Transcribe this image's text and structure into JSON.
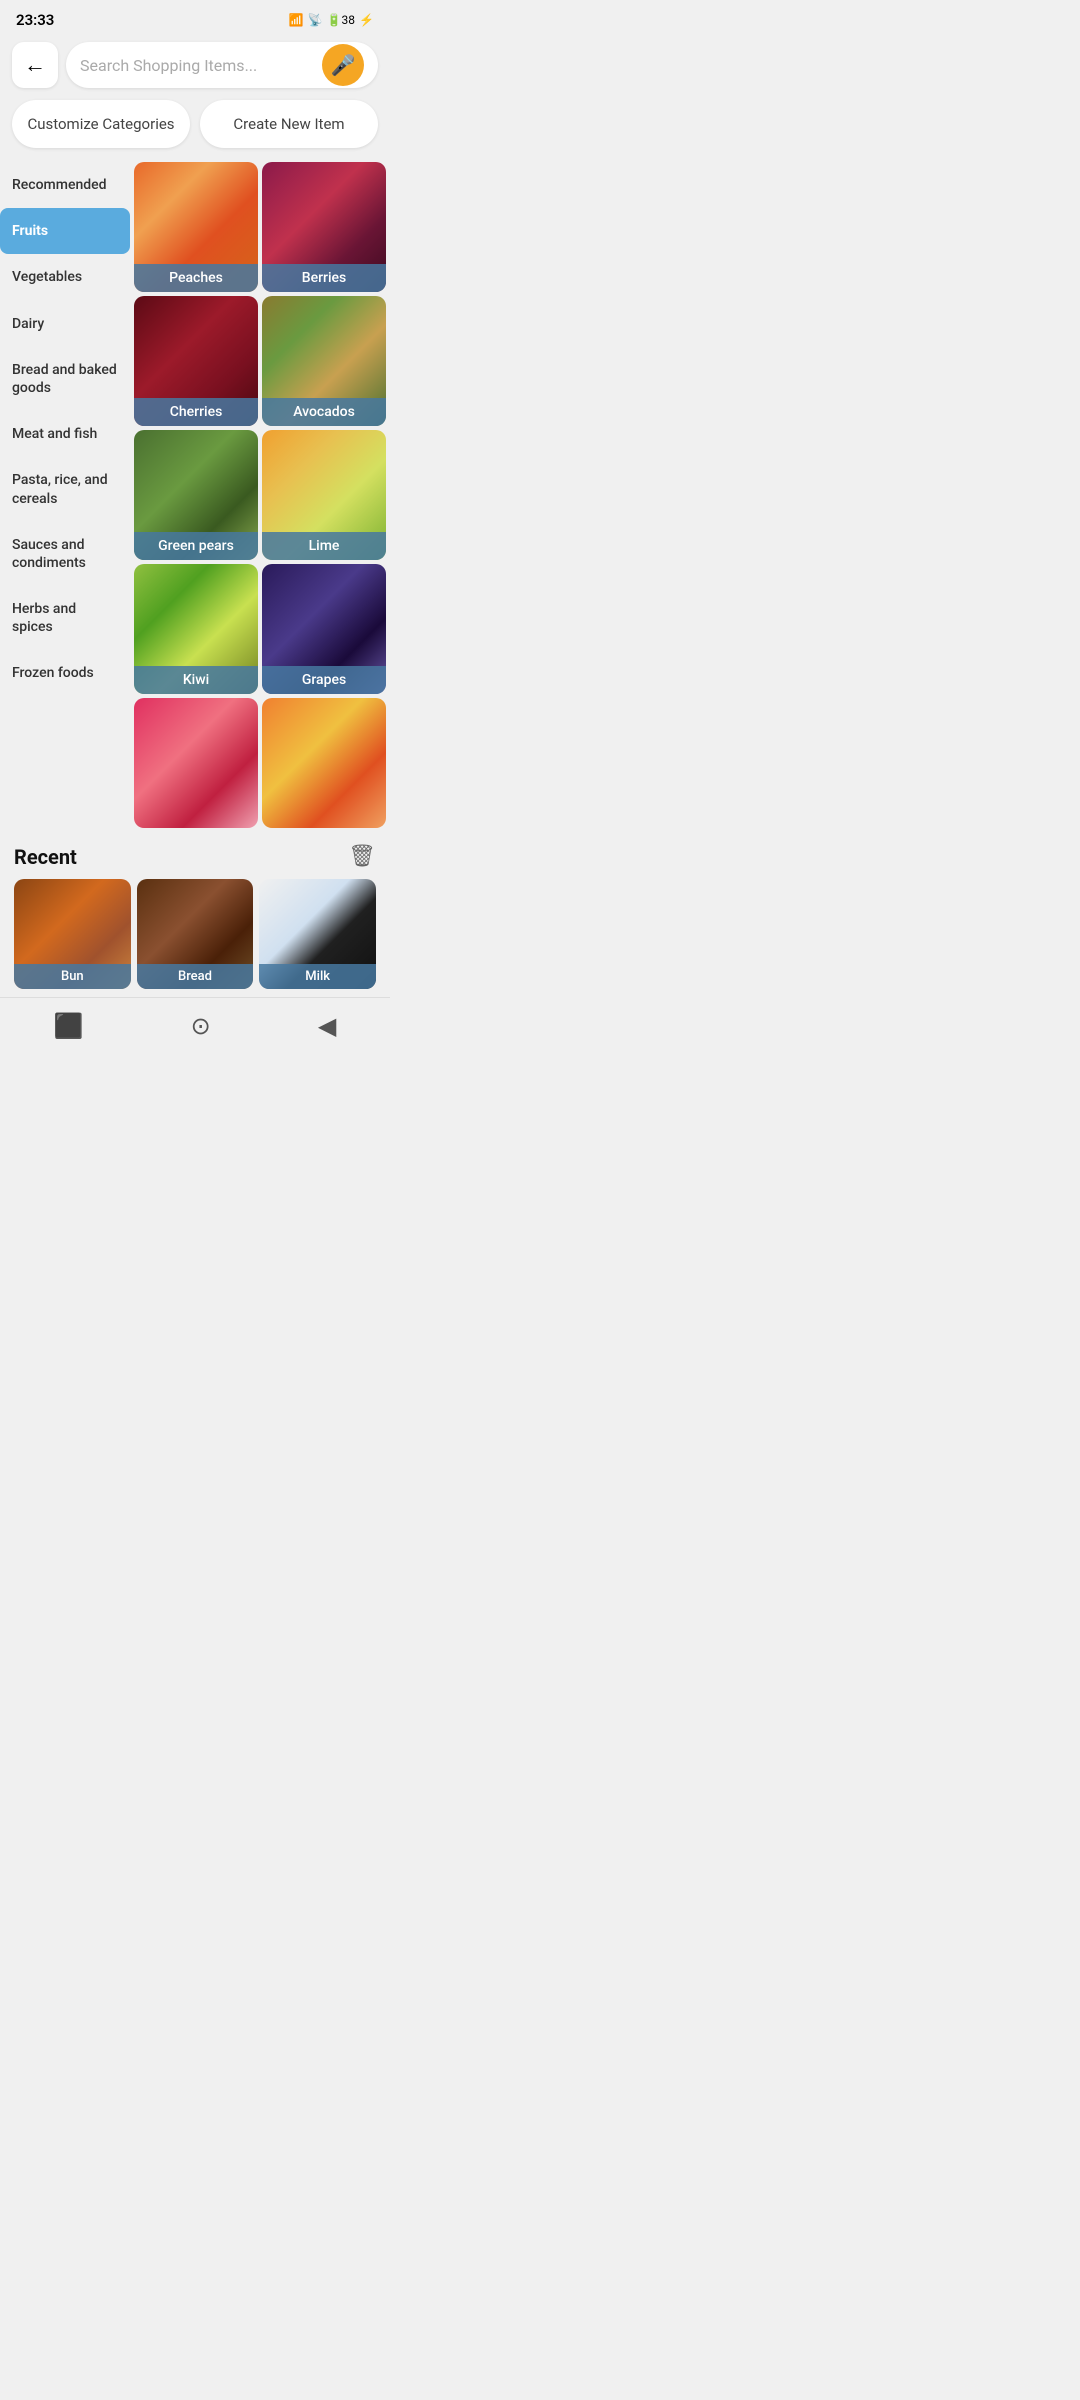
{
  "statusBar": {
    "time": "23:33",
    "battery": "38",
    "signal": "●●●●"
  },
  "search": {
    "placeholder": "Search Shopping Items..."
  },
  "buttons": {
    "customize": "Customize Categories",
    "createNew": "Create New Item"
  },
  "sidebar": {
    "items": [
      {
        "id": "recommended",
        "label": "Recommended",
        "active": false
      },
      {
        "id": "fruits",
        "label": "Fruits",
        "active": true
      },
      {
        "id": "vegetables",
        "label": "Vegetables",
        "active": false
      },
      {
        "id": "dairy",
        "label": "Dairy",
        "active": false
      },
      {
        "id": "bread",
        "label": "Bread and baked goods",
        "active": false
      },
      {
        "id": "meat",
        "label": "Meat and fish",
        "active": false
      },
      {
        "id": "pasta",
        "label": "Pasta, rice, and cereals",
        "active": false
      },
      {
        "id": "sauces",
        "label": "Sauces and condiments",
        "active": false
      },
      {
        "id": "herbs",
        "label": "Herbs and spices",
        "active": false
      },
      {
        "id": "frozen",
        "label": "Frozen foods",
        "active": false
      }
    ]
  },
  "fruitGrid": [
    {
      "id": "peaches",
      "label": "Peaches",
      "imgClass": "img-peaches"
    },
    {
      "id": "berries",
      "label": "Berries",
      "imgClass": "img-berries"
    },
    {
      "id": "cherries",
      "label": "Cherries",
      "imgClass": "img-cherries"
    },
    {
      "id": "avocados",
      "label": "Avocados",
      "imgClass": "img-avocados"
    },
    {
      "id": "green-pears",
      "label": "Green pears",
      "imgClass": "img-green-pears"
    },
    {
      "id": "lime",
      "label": "Lime",
      "imgClass": "img-lime"
    },
    {
      "id": "kiwi",
      "label": "Kiwi",
      "imgClass": "img-kiwi"
    },
    {
      "id": "grapes",
      "label": "Grapes",
      "imgClass": "img-grapes"
    },
    {
      "id": "partial1",
      "label": "",
      "imgClass": "img-partial1"
    },
    {
      "id": "partial2",
      "label": "",
      "imgClass": "img-partial2"
    }
  ],
  "recent": {
    "title": "Recent",
    "items": [
      {
        "id": "bun",
        "label": "Bun",
        "imgClass": "img-bun"
      },
      {
        "id": "bread",
        "label": "Bread",
        "imgClass": "img-bread"
      },
      {
        "id": "milk",
        "label": "Milk",
        "imgClass": "img-milk"
      }
    ]
  },
  "navBar": {
    "homeIcon": "⬛",
    "circleIcon": "⊙",
    "backIcon": "◀"
  }
}
